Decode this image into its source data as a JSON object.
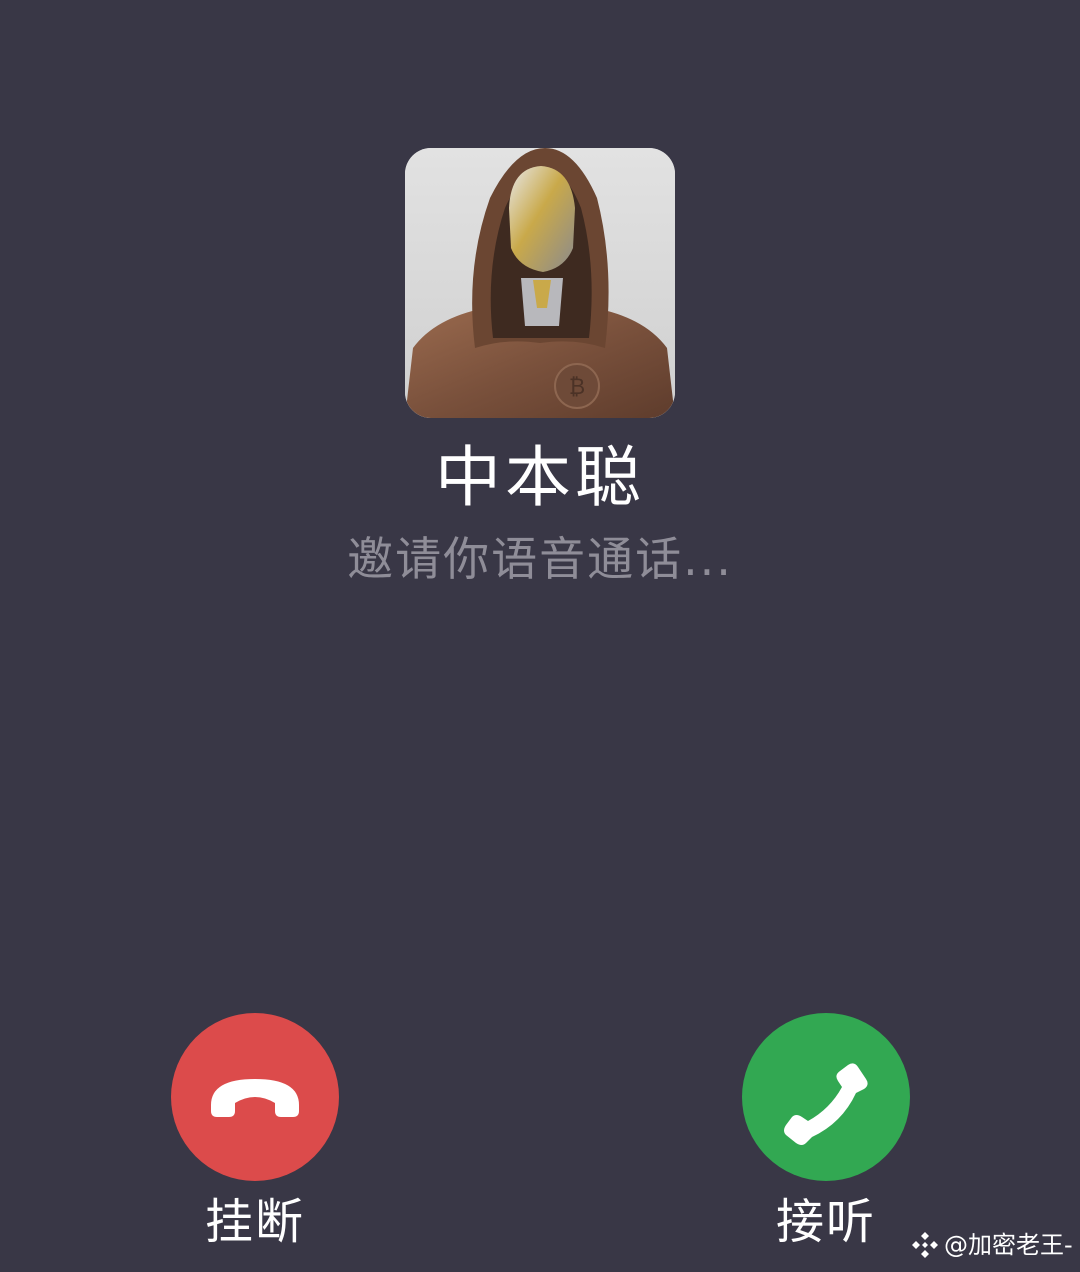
{
  "caller": {
    "name": "中本聪",
    "status": "邀请你语音通话..."
  },
  "actions": {
    "decline_label": "挂断",
    "accept_label": "接听"
  },
  "icons": {
    "decline": "phone-hangup-icon",
    "accept": "phone-answer-icon",
    "watermark_logo": "diamond-logo-icon"
  },
  "watermark": {
    "text": "@加密老王-"
  },
  "colors": {
    "background": "#393746",
    "decline": "#dc4b4b",
    "accept": "#32a852",
    "status_text": "#8f8d98"
  }
}
